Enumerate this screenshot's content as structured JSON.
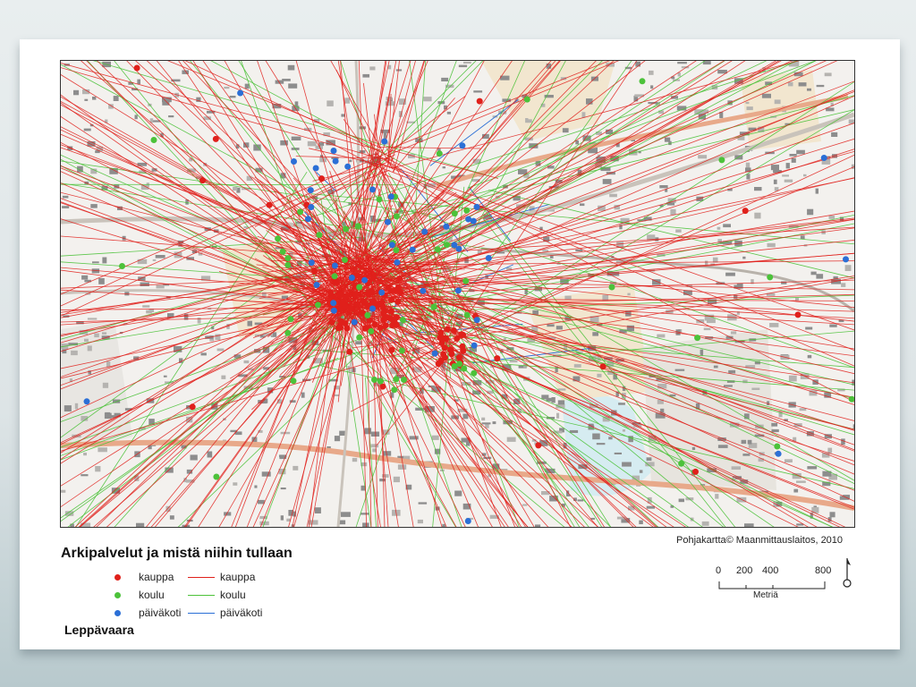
{
  "legend": {
    "title": "Arkipalvelut ja mistä niihin tullaan",
    "items": [
      {
        "point_label": "kauppa",
        "line_label": "kauppa",
        "color": "#e0201b"
      },
      {
        "point_label": "koulu",
        "line_label": "koulu",
        "color": "#4cc23a"
      },
      {
        "point_label": "päiväkoti",
        "line_label": "päiväkoti",
        "color": "#2b6fd6"
      }
    ]
  },
  "place_name": "Leppävaara",
  "credit": "Pohjakartta© Maanmittauslaitos, 2010",
  "scale": {
    "ticks": [
      "0",
      "200",
      "400",
      "800"
    ],
    "unit": "Metriä"
  },
  "icons": [
    "north-arrow-icon"
  ]
}
